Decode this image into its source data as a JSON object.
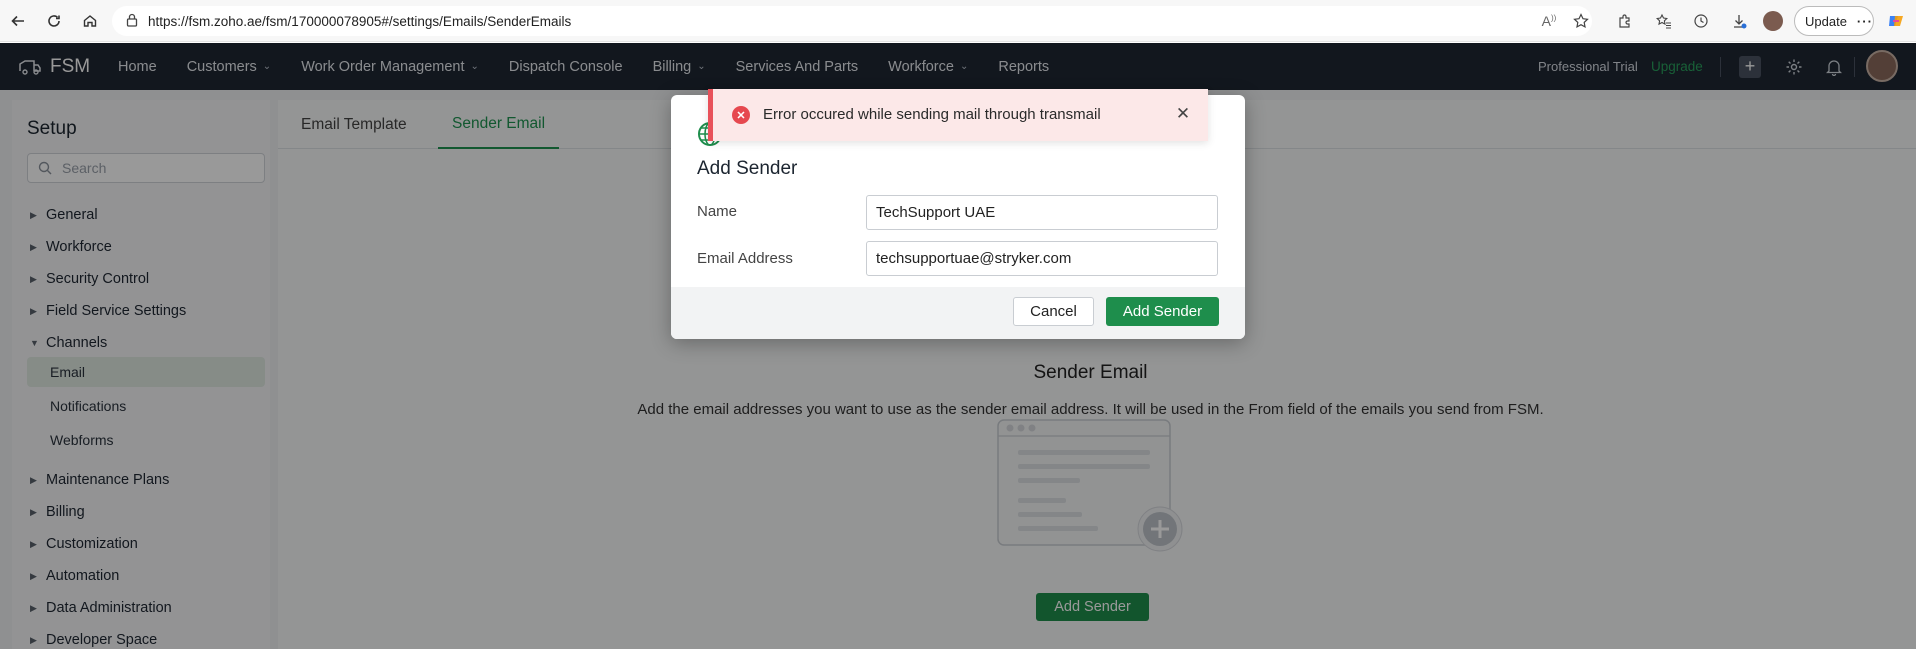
{
  "browser": {
    "url": "https://fsm.zoho.ae/fsm/170000078905#/settings/Emails/SenderEmails",
    "update_label": "Update"
  },
  "header": {
    "logo_text": "FSM",
    "nav": [
      {
        "label": "Home",
        "has_dropdown": false
      },
      {
        "label": "Customers",
        "has_dropdown": true
      },
      {
        "label": "Work Order Management",
        "has_dropdown": true
      },
      {
        "label": "Dispatch Console",
        "has_dropdown": false
      },
      {
        "label": "Billing",
        "has_dropdown": true
      },
      {
        "label": "Services And Parts",
        "has_dropdown": false
      },
      {
        "label": "Workforce",
        "has_dropdown": true
      },
      {
        "label": "Reports",
        "has_dropdown": false
      }
    ],
    "trial_text": "Professional Trial",
    "upgrade_text": "Upgrade"
  },
  "sidebar": {
    "title": "Setup",
    "search_placeholder": "Search",
    "items": [
      {
        "label": "General",
        "expanded": false
      },
      {
        "label": "Workforce",
        "expanded": false
      },
      {
        "label": "Security Control",
        "expanded": false
      },
      {
        "label": "Field Service Settings",
        "expanded": false
      },
      {
        "label": "Channels",
        "expanded": true
      }
    ],
    "channels_sub": [
      {
        "label": "Email",
        "active": true
      },
      {
        "label": "Notifications",
        "active": false
      },
      {
        "label": "Webforms",
        "active": false
      }
    ],
    "items_after": [
      {
        "label": "Maintenance Plans"
      },
      {
        "label": "Billing"
      },
      {
        "label": "Customization"
      },
      {
        "label": "Automation"
      },
      {
        "label": "Data Administration"
      },
      {
        "label": "Developer Space"
      }
    ]
  },
  "tabs": [
    {
      "label": "Email Template",
      "active": false
    },
    {
      "label": "Sender Email",
      "active": true
    }
  ],
  "empty_state": {
    "title": "Sender Email",
    "description": "Add the email addresses you want to use as the sender email address. It will be used in the From field of the emails you send from FSM.",
    "button_label": "Add Sender"
  },
  "modal": {
    "title": "Add Sender",
    "name_label": "Name",
    "name_value": "TechSupport UAE",
    "email_label": "Email Address",
    "email_value": "techsupportuae@stryker.com",
    "cancel_label": "Cancel",
    "submit_label": "Add Sender"
  },
  "toast": {
    "type": "error",
    "message": "Error occured while sending mail through transmail"
  },
  "colors": {
    "header_bg": "#1f2733",
    "accent_green": "#1e8e4c",
    "error_red": "#e8515a"
  }
}
